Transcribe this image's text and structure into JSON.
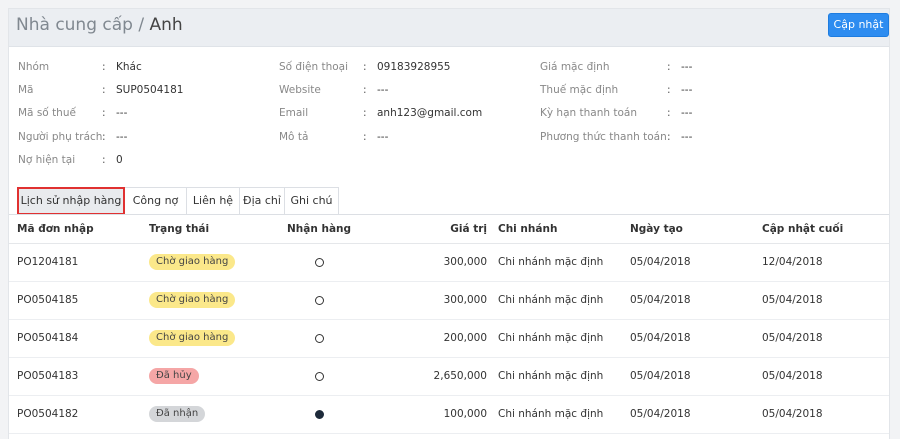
{
  "header": {
    "title_prefix": "Nhà cung cấp /",
    "title_name": "Anh",
    "update_button": "Cập nhật"
  },
  "info": {
    "col1": [
      {
        "label": "Nhóm",
        "value": "Khác"
      },
      {
        "label": "Mã",
        "value": "SUP0504181"
      },
      {
        "label": "Mã số thuế",
        "value": "---"
      },
      {
        "label": "Người phụ trách",
        "value": "---"
      },
      {
        "label": "Nợ hiện tại",
        "value": "0"
      }
    ],
    "col2": [
      {
        "label": "Số điện thoại",
        "value": "09183928955"
      },
      {
        "label": "Website",
        "value": "---"
      },
      {
        "label": "Email",
        "value": "anh123@gmail.com"
      },
      {
        "label": "Mô tả",
        "value": "---"
      }
    ],
    "col3": [
      {
        "label": "Giá mặc định",
        "value": "---"
      },
      {
        "label": "Thuế mặc định",
        "value": "---"
      },
      {
        "label": "Kỳ hạn thanh toán",
        "value": "---"
      },
      {
        "label": "Phương thức thanh toán",
        "value": "---"
      }
    ],
    "colon": ":"
  },
  "tabs": [
    {
      "label": "Lịch sử nhập hàng",
      "active": true
    },
    {
      "label": "Công nợ"
    },
    {
      "label": "Liên hệ"
    },
    {
      "label": "Địa chỉ"
    },
    {
      "label": "Ghi chú"
    }
  ],
  "table": {
    "headers": [
      "Mã đơn nhập",
      "Trạng thái",
      "Nhận hàng",
      "Giá trị",
      "Chi nhánh",
      "Ngày tạo",
      "Cập nhật cuối"
    ],
    "rows": [
      {
        "code": "PO1204181",
        "status": "Chờ giao hàng",
        "received": false,
        "value": "300,000",
        "branch": "Chi nhánh mặc định",
        "created": "05/04/2018",
        "updated": "12/04/2018"
      },
      {
        "code": "PO0504185",
        "status": "Chờ giao hàng",
        "received": false,
        "value": "300,000",
        "branch": "Chi nhánh mặc định",
        "created": "05/04/2018",
        "updated": "05/04/2018"
      },
      {
        "code": "PO0504184",
        "status": "Chờ giao hàng",
        "received": false,
        "value": "200,000",
        "branch": "Chi nhánh mặc định",
        "created": "05/04/2018",
        "updated": "05/04/2018"
      },
      {
        "code": "PO0504183",
        "status": "Đã hủy",
        "received": false,
        "value": "2,650,000",
        "branch": "Chi nhánh mặc định",
        "created": "05/04/2018",
        "updated": "05/04/2018"
      },
      {
        "code": "PO0504182",
        "status": "Đã nhận",
        "received": true,
        "value": "100,000",
        "branch": "Chi nhánh mặc định",
        "created": "05/04/2018",
        "updated": "05/04/2018"
      }
    ]
  },
  "status_colors": {
    "Chờ giao hàng": "#fbe88a",
    "Đã hủy": "#f5a6a6",
    "Đã nhận": "#d4d6d9"
  },
  "icons": {
    "not_received": "circle-outline-icon",
    "received": "circle-filled-icon"
  },
  "colors": {
    "accent": "#2d8cf0",
    "active_tab_outline": "#e03131"
  }
}
